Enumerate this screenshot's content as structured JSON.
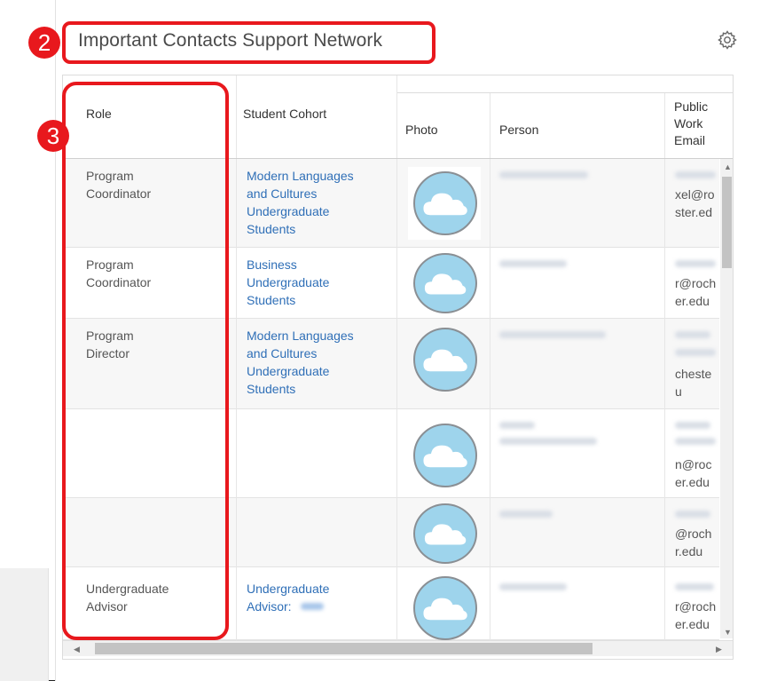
{
  "panel": {
    "title": "Important Contacts Support Network",
    "settings_icon": "gear-icon"
  },
  "annotations": {
    "title_callout": "2",
    "column_callout": "3",
    "highlight_color": "#e8181d"
  },
  "table": {
    "headers": {
      "role": "Role",
      "cohort": "Student Cohort",
      "photo": "Photo",
      "person": "Person",
      "email": "Public\nWork\nEmail"
    },
    "rows": [
      {
        "role": "Program\nCoordinator",
        "cohort": "Modern Languages\nand Cultures\nUndergraduate\nStudents",
        "email_visible": "xel@ro\nster.ed"
      },
      {
        "role": "Program\nCoordinator",
        "cohort": "Business\nUndergraduate\nStudents",
        "email_visible": "r@roch\ner.edu"
      },
      {
        "role": "Program\nDirector",
        "cohort": "Modern Languages\nand Cultures\nUndergraduate\nStudents",
        "email_visible": "cheste\nu"
      },
      {
        "role": "",
        "cohort": "",
        "email_visible": "n@roc\ner.edu"
      },
      {
        "role": "",
        "cohort": "",
        "email_visible": "@roch\nr.edu"
      },
      {
        "role": "Undergraduate\nAdvisor",
        "cohort": "Undergraduate\nAdvisor:",
        "email_visible": "r@roch\ner.edu"
      }
    ],
    "photo_icon": "cloud-icon",
    "link_color": "#2f6fb7",
    "avatar_color": "#9ed4ec"
  }
}
